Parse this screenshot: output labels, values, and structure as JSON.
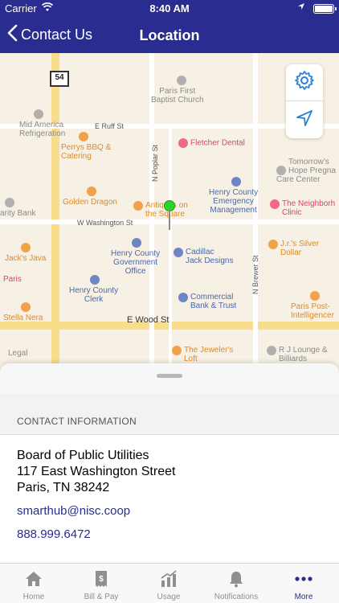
{
  "status_bar": {
    "carrier": "Carrier",
    "time": "8:40 AM"
  },
  "nav": {
    "back_label": "Contact Us",
    "title": "Location"
  },
  "map": {
    "route_shield": "54",
    "places": [
      {
        "name": "Paris First\nBaptist Church",
        "color": "gray"
      },
      {
        "name": "Mid America\nRefrigeration",
        "color": "gray"
      },
      {
        "name": "Perrys BBQ &\nCatering",
        "color": "orange"
      },
      {
        "name": "Fletcher Dental",
        "color": "pink"
      },
      {
        "name": "Tomorrow's\nHope Pregna\nCare Center",
        "color": "gray"
      },
      {
        "name": "Golden Dragon",
        "color": "orange"
      },
      {
        "name": "Antiques on\nthe Square",
        "color": "orange"
      },
      {
        "name": "Henry County\nEmergency\nManagement",
        "color": "blue"
      },
      {
        "name": "The Neighborh\nClinic",
        "color": "pink"
      },
      {
        "name": "arity Bank",
        "color": "gray"
      },
      {
        "name": "Jack's Java",
        "color": "orange"
      },
      {
        "name": "Henry County\nGovernment\nOffice",
        "color": "blue"
      },
      {
        "name": "Cadillac\nJack Designs",
        "color": "blue"
      },
      {
        "name": "J.r.'s Silver\nDollar",
        "color": "orange"
      },
      {
        "name": "Paris",
        "color": "pink"
      },
      {
        "name": "Henry County\nClerk",
        "color": "blue"
      },
      {
        "name": "Commercial\nBank & Trust",
        "color": "blue"
      },
      {
        "name": "Paris Post-\nIntelligencer",
        "color": "orange"
      },
      {
        "name": "Stella Nera",
        "color": "orange"
      },
      {
        "name": "The Jeweler's\nLoft",
        "color": "orange"
      },
      {
        "name": "R J Lounge &\nBilliards",
        "color": "gray"
      },
      {
        "name": "Legal",
        "color": "gray"
      }
    ],
    "streets": [
      "E Ruff St",
      "W Washington St",
      "E Wood St",
      "N Poplar St",
      "N Brewer St"
    ]
  },
  "contact": {
    "section_header": "CONTACT INFORMATION",
    "org_name": "Board of Public Utilities",
    "address_line1": "117 East Washington Street",
    "address_line2": "Paris, TN 38242",
    "email": "smarthub@nisc.coop",
    "phone": "888.999.6472"
  },
  "tabs": [
    {
      "label": "Home",
      "icon": "home-icon"
    },
    {
      "label": "Bill & Pay",
      "icon": "bill-icon"
    },
    {
      "label": "Usage",
      "icon": "usage-chart-icon"
    },
    {
      "label": "Notifications",
      "icon": "bell-icon"
    },
    {
      "label": "More",
      "icon": "more-dots-icon",
      "active": true
    }
  ],
  "colors": {
    "brand": "#2a2d8f",
    "tab_inactive": "#8e8e93"
  }
}
